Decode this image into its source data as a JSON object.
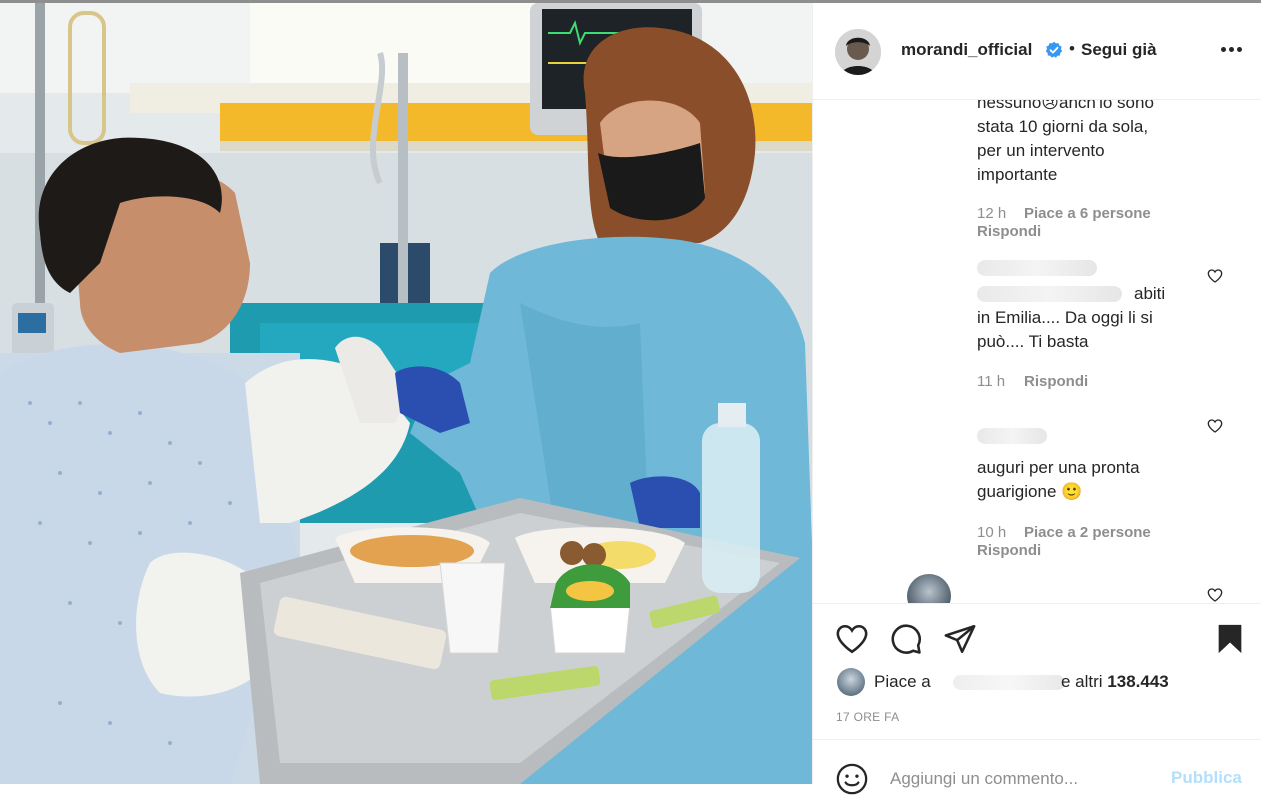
{
  "post": {
    "username": "morandi_official",
    "verified_icon": "verified-badge-icon",
    "separator": "•",
    "follow_label": "Segui già",
    "more_icon": "more-options-icon"
  },
  "comments": [
    {
      "text_lines": [
        "nessuno😢anch'io sono",
        "stata 10 giorni da sola,",
        "per un intervento",
        "importante"
      ],
      "time": "12 h",
      "likes": "Piace a 6 persone",
      "reply": "Rispondi"
    },
    {
      "text_lines": [
        "abiti",
        "in Emilia.... Da oggi li si",
        "può.... Ti basta"
      ],
      "time": "11 h",
      "reply": "Rispondi"
    },
    {
      "text_lines": [
        "auguri per una pronta",
        "guarigione 🙂"
      ],
      "time": "10 h",
      "likes": "Piace a 2 persone",
      "reply": "Rispondi"
    }
  ],
  "actions": {
    "like_icon": "heart-icon",
    "comment_icon": "comment-bubble-icon",
    "share_icon": "paper-plane-icon",
    "save_icon": "bookmark-icon"
  },
  "likes": {
    "prefix": "Piace a",
    "suffix_pre": "e altri ",
    "count": "138.443"
  },
  "timestamp": "17 ORE FA",
  "add_comment": {
    "emoji_icon": "smiley-face-icon",
    "placeholder": "Aggiungi un commento...",
    "publish_label": "Pubblica"
  },
  "colors": {
    "verified": "#3897f0",
    "text": "#262626",
    "muted": "#8e8e8e",
    "publish_disabled": "#b3dffc",
    "gown_blue": "#6fb8d8"
  }
}
